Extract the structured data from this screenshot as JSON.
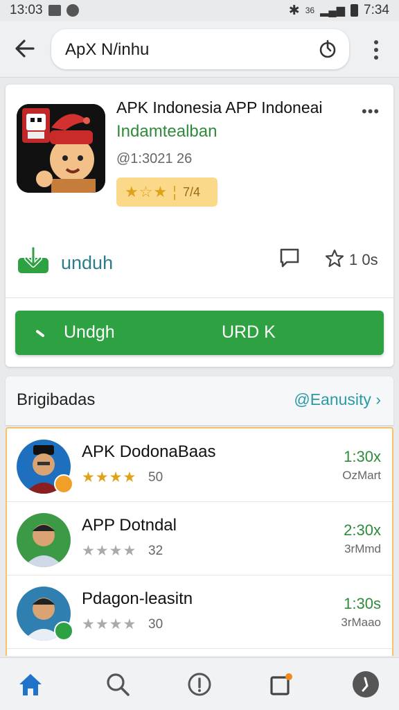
{
  "status_bar": {
    "time": "13:03",
    "right_text": "7:34",
    "signal": "36"
  },
  "search": {
    "query": "ApX N/inhu"
  },
  "app": {
    "title": "APK Indonesia APP Indoneai",
    "developer": "Indamtealban",
    "meta": "@1:3021 26",
    "rating_text": "7/4",
    "action_label": "unduh",
    "favorite_count": "1 0s",
    "button_left_label": "Undgh",
    "button_right_label": "URD K",
    "colors": {
      "accent_green": "#2ea143",
      "link_teal": "#2a9aa6",
      "rating_bg": "#fbd98a"
    }
  },
  "section": {
    "title": "Brigibadas",
    "link": "@Eanusity"
  },
  "list": [
    {
      "name": "APK DodonaBaas",
      "stars": "★★★★",
      "rating_count": "50",
      "size": "1:30x",
      "sub": "OzMart",
      "avatar_bg": "#1f6fbf",
      "badge_color": "#f0a028"
    },
    {
      "name": "APP Dotndal",
      "stars": "★★★★",
      "rating_count": "32",
      "size": "2:30x",
      "sub": "3rMmd",
      "avatar_bg": "#3c9a46",
      "badge_color": ""
    },
    {
      "name": "Pdagon-leasitn",
      "stars": "★★★★",
      "rating_count": "30",
      "size": "1:30s",
      "sub": "3rMaao",
      "avatar_bg": "#2f7fb0",
      "badge_color": "#2ea143"
    }
  ],
  "nav": {
    "items": [
      "home-icon",
      "search-icon",
      "info-icon",
      "notifications-icon",
      "profile-icon"
    ]
  }
}
